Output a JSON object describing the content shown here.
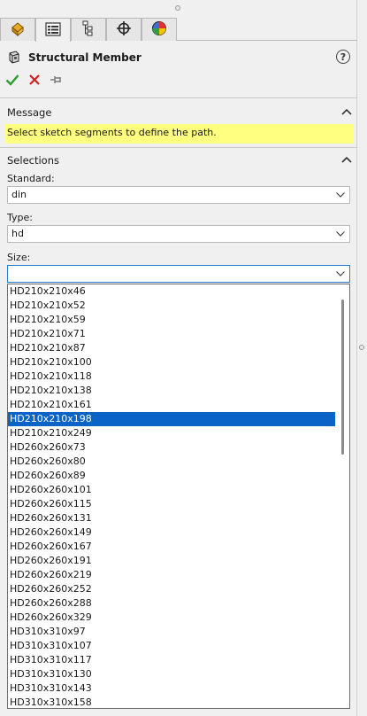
{
  "tabs": [
    {
      "icon": "feature-manager-icon"
    },
    {
      "icon": "property-manager-icon"
    },
    {
      "icon": "configuration-manager-icon"
    },
    {
      "icon": "dimxpert-manager-icon"
    },
    {
      "icon": "display-manager-icon"
    }
  ],
  "active_tab": 1,
  "header": {
    "title": "Structural Member",
    "help": "?"
  },
  "message": {
    "title": "Message",
    "text": "Select sketch segments to define the path."
  },
  "selections": {
    "title": "Selections",
    "standard_label": "Standard:",
    "standard_value": "din",
    "type_label": "Type:",
    "type_value": "hd",
    "size_label": "Size:",
    "size_value": ""
  },
  "size_options": [
    "HD210x210x46",
    "HD210x210x52",
    "HD210x210x59",
    "HD210x210x71",
    "HD210x210x87",
    "HD210x210x100",
    "HD210x210x118",
    "HD210x210x138",
    "HD210x210x161",
    "HD210x210x198",
    "HD210x210x249",
    "HD260x260x73",
    "HD260x260x80",
    "HD260x260x89",
    "HD260x260x101",
    "HD260x260x115",
    "HD260x260x131",
    "HD260x260x149",
    "HD260x260x167",
    "HD260x260x191",
    "HD260x260x219",
    "HD260x260x252",
    "HD260x260x288",
    "HD260x260x329",
    "HD310x310x97",
    "HD310x310x107",
    "HD310x310x117",
    "HD310x310x130",
    "HD310x310x143",
    "HD310x310x158"
  ],
  "selected_option": "HD210x210x198",
  "colors": {
    "accept": "#2e9b2e",
    "cancel": "#d42020",
    "message_bg": "#ffff80",
    "selection_bg": "#0a64c8",
    "focus_border": "#2a7bd3"
  }
}
